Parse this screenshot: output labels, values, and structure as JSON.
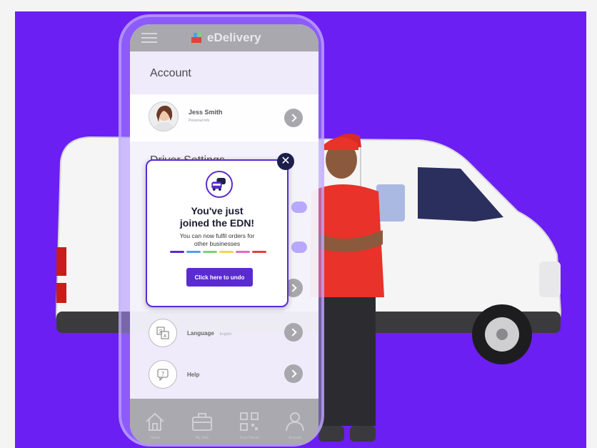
{
  "app": {
    "brand": "eDelivery"
  },
  "account": {
    "title": "Account",
    "user_name": "Jess Smith",
    "user_sub": "Personal Info"
  },
  "driver_settings": {
    "title": "Driver Settings"
  },
  "settings_items": [
    {
      "label": "Language",
      "value": "English",
      "icon": "language-icon"
    },
    {
      "label": "Help",
      "value": "",
      "icon": "help-icon"
    }
  ],
  "nav": [
    {
      "label": "Home",
      "icon": "home-icon"
    },
    {
      "label": "My Jobs",
      "icon": "briefcase-icon"
    },
    {
      "label": "Scan Parcel",
      "icon": "qr-code-icon"
    },
    {
      "label": "Account",
      "icon": "user-icon"
    }
  ],
  "popup": {
    "title_line1": "You've just",
    "title_line2": "joined the EDN!",
    "body_line1": "You can now fulfil orders for",
    "body_line2": "other businesses",
    "button": "Click here to undo",
    "close_symbol": "✕",
    "stripe_colors": [
      "#5a2bd1",
      "#4aa3e8",
      "#7ed07a",
      "#f2d64b",
      "#e36ac9",
      "#e0433a"
    ]
  },
  "colors": {
    "background": "#6b1ff2",
    "accent": "#5a2bd1",
    "driver_shirt": "#e8322a"
  }
}
